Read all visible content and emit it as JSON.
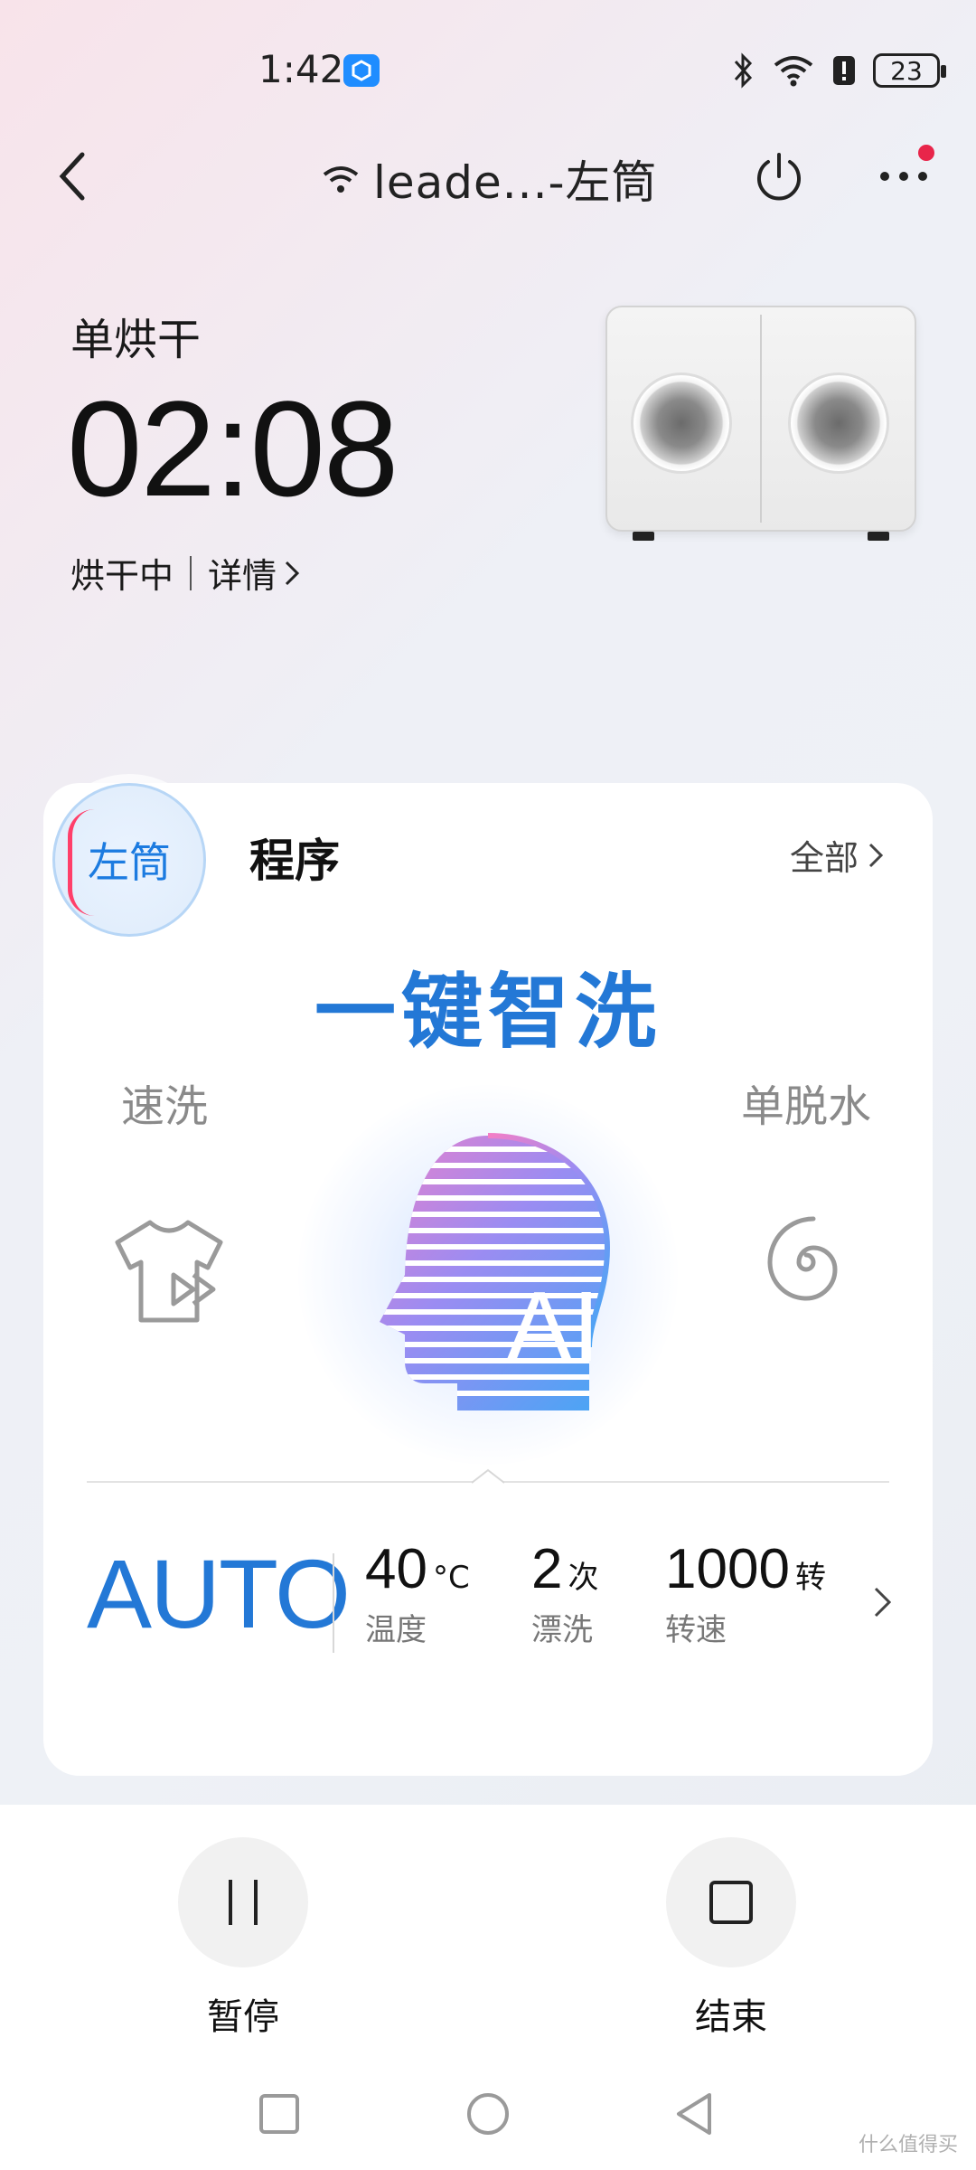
{
  "status_bar": {
    "time": "1:42",
    "battery": "23"
  },
  "header": {
    "title": "leade...-左筒"
  },
  "status": {
    "mode": "单烘干",
    "timer": "02:08",
    "state": "烘干中",
    "detail_label": "详情"
  },
  "card": {
    "drum_badge": "左筒",
    "title": "程序",
    "all_label": "全部",
    "program_name": "一键智洗",
    "left_program": "速洗",
    "right_program": "单脱水",
    "ai_text": "AI",
    "mode_value": "AUTO",
    "params": [
      {
        "value": "40",
        "unit": "°C",
        "label": "温度"
      },
      {
        "value": "2",
        "unit": "次",
        "label": "漂洗"
      },
      {
        "value": "1000",
        "unit": "转",
        "label": "转速"
      }
    ]
  },
  "controls": {
    "pause_label": "暂停",
    "end_label": "结束"
  },
  "watermark": "什么值得买",
  "colors": {
    "accent": "#2378d6",
    "notification": "#e8254a"
  }
}
